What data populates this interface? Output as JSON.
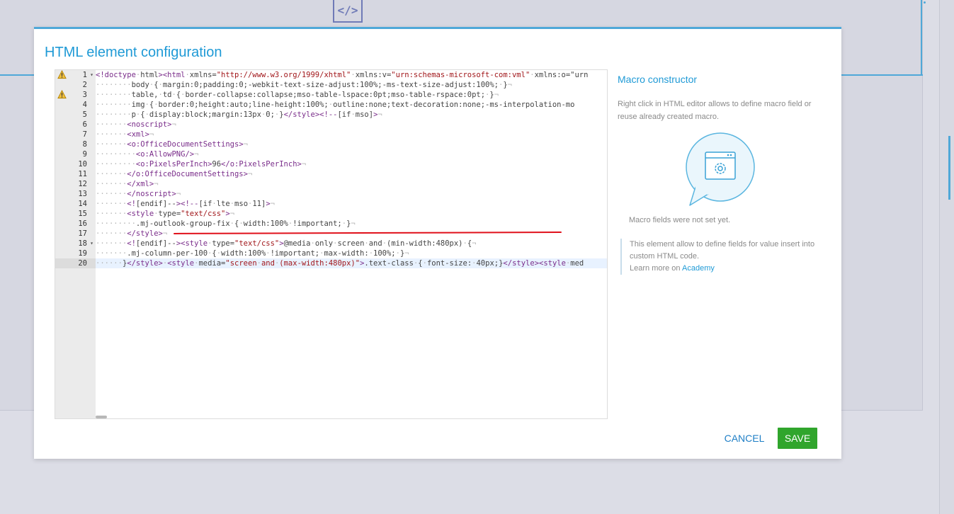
{
  "dialog": {
    "title": "HTML element configuration",
    "cancel_label": "CANCEL",
    "save_label": "SAVE"
  },
  "editor": {
    "active_line": 20,
    "warning_lines": [
      1,
      3
    ],
    "foldable_lines": [
      1,
      18
    ],
    "lines": [
      "<!doctype·html><html·xmlns=\"http://www.w3.org/1999/xhtml\"·xmlns:v=\"urn:schemas-microsoft-com:vml\"·xmlns:o=\"urn",
      "········body·{·margin:0;padding:0;-webkit-text-size-adjust:100%;-ms-text-size-adjust:100%;·}¬",
      "········table,·td·{·border-collapse:collapse;mso-table-lspace:0pt;mso-table-rspace:0pt;·}¬",
      "········img·{·border:0;height:auto;line-height:100%;·outline:none;text-decoration:none;-ms-interpolation-mo",
      "········p·{·display:block;margin:13px·0;·}</style><!--[if·mso]>¬",
      "·······<noscript>¬",
      "·······<xml>¬",
      "·······<o:OfficeDocumentSettings>¬",
      "·········<o:AllowPNG/>¬",
      "·········<o:PixelsPerInch>96</o:PixelsPerInch>¬",
      "·······</o:OfficeDocumentSettings>¬",
      "·······</xml>¬",
      "·······</noscript>¬",
      "·······<![endif]--><!--[if·lte·mso·11]>¬",
      "·······<style·type=\"text/css\">¬",
      "·········.mj-outlook-group-fix·{·width:100%·!important;·}¬",
      "·······</style>¬",
      "·······<![endif]--><style·type=\"text/css\">@media·only·screen·and·(min-width:480px)·{¬",
      "·······.mj-column-per-100·{·width:100%·!important;·max-width:·100%;·}¬",
      "······}</style>·<style·media=\"screen·and·(max-width:480px)\">.text-class·{·font-size:·40px;}</style><style·med"
    ]
  },
  "macro": {
    "title": "Macro constructor",
    "description": "Right click in HTML editor allows to define macro field or reuse already created macro.",
    "empty_text": "Macro fields were not set yet.",
    "info_text": "This element allow to define fields for value insert into custom HTML code.",
    "learn_more_prefix": "Learn more on ",
    "learn_more_link": "Academy"
  },
  "colors": {
    "accent": "#1f9ad6",
    "save_button": "#30a52c",
    "annotation": "#e0101a"
  }
}
